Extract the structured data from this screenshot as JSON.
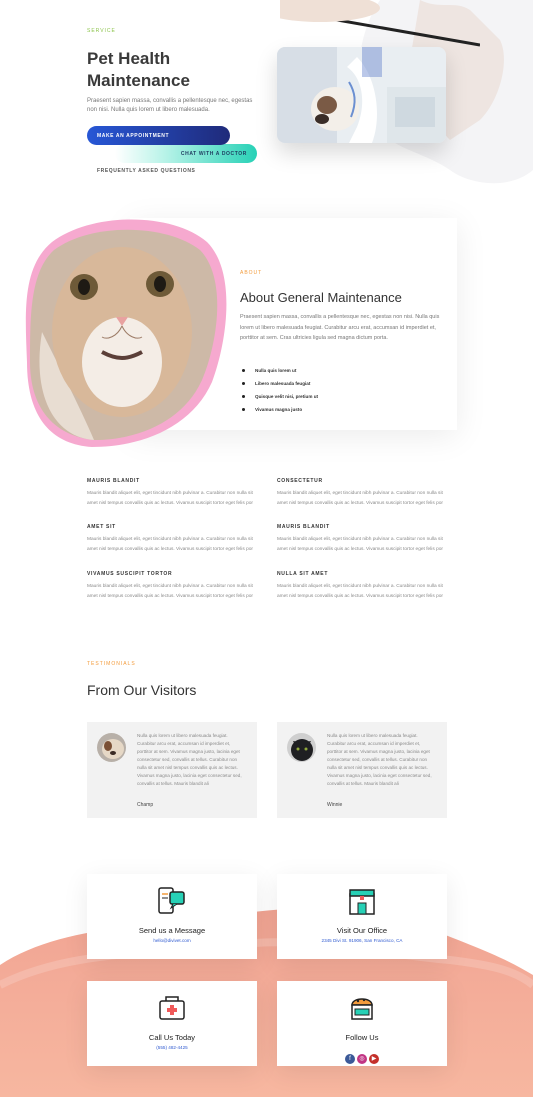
{
  "hero": {
    "eyebrow": "SERVICE",
    "title": "Pet Health Maintenance",
    "description": "Praesent sapien massa, convallis a pellentesque nec, egestas non nisi. Nulla quis lorem ut libero malesuada.",
    "appointment_button": "MAKE AN APPOINTMENT",
    "chat_button": "CHAT WITH A DOCTOR",
    "faq_link": "FREQUENTLY ASKED QUESTIONS"
  },
  "about": {
    "eyebrow": "ABOUT",
    "title": "About General Maintenance",
    "text": "Praesent sapien massa, convallis a pellentesque nec, egestas non nisi. Nulla quis lorem ut libero malesuada feugiat. Curabitur arcu erat, accumsan id imperdiet et, porttitor at sem. Cras ultricies ligula sed magna dictum porta.",
    "bullets": [
      "Nulla quis lorem ut",
      "Libero malesuada feugiat",
      "Quisque velit nisi, pretium ut",
      "Vivamus magna justo"
    ]
  },
  "features": [
    {
      "heading": "MAURIS BLANDIT",
      "text": "Mauris blandit aliquet elit, eget tincidunt nibh pulvinar a. Curabitur non nulla sit amet nisl tempus convallis quis ac lectus. Vivamus suscipit tortor eget felis por"
    },
    {
      "heading": "CONSECTETUR",
      "text": "Mauris blandit aliquet elit, eget tincidunt nibh pulvinar a. Curabitur non nulla sit amet nisl tempus convallis quis ac lectus. Vivamus suscipit tortor eget felis por"
    },
    {
      "heading": "AMET SIT",
      "text": "Mauris blandit aliquet elit, eget tincidunt nibh pulvinar a. Curabitur non nulla sit amet nisl tempus convallis quis ac lectus. Vivamus suscipit tortor eget felis por"
    },
    {
      "heading": "MAURIS BLANDIT",
      "text": "Mauris blandit aliquet elit, eget tincidunt nibh pulvinar a. Curabitur non nulla sit amet nisl tempus convallis quis ac lectus. Vivamus suscipit tortor eget felis por"
    },
    {
      "heading": "VIVAMUS SUSCIPIT TORTOR",
      "text": "Mauris blandit aliquet elit, eget tincidunt nibh pulvinar a. Curabitur non nulla sit amet nisl tempus convallis quis ac lectus. Vivamus suscipit tortor eget felis por"
    },
    {
      "heading": "NULLA SIT AMET",
      "text": "Mauris blandit aliquet elit, eget tincidunt nibh pulvinar a. Curabitur non nulla sit amet nisl tempus convallis quis ac lectus. Vivamus suscipit tortor eget felis por"
    }
  ],
  "testimonials": {
    "eyebrow": "TESTIMONIALS",
    "title": "From Our Visitors",
    "items": [
      {
        "text": "Nulla quis lorem ut libero malesuada feugiat. Curabitur arcu erat, accumsan id imperdiet et, porttitor at sem. Vivamus magna justo, lacinia eget consectetur sed, convallis at tellus. Curabitur non nulla sit amet nisl tempus convallis quis ac lectus. Vivamus magna justo, lacinia eget consectetur sed, convallis at tellus. Mauris blandit ali",
        "name": "Champ"
      },
      {
        "text": "Nulla quis lorem ut libero malesuada feugiat. Curabitur arcu erat, accumsan id imperdiet et, porttitor at sem. Vivamus magna justo, lacinia eget consectetur sed, convallis at tellus. Curabitur non nulla sit amet nisl tempus convallis quis ac lectus. Vivamus magna justo, lacinia eget consectetur sed, convallis at tellus. Mauris blandit ali",
        "name": "Winnie"
      }
    ]
  },
  "contact": {
    "message": {
      "title": "Send us a Message",
      "sub": "hello@divivet.com"
    },
    "office": {
      "title": "Visit Our Office",
      "sub": "2345 Divi St. 91906, San Francisco, CA"
    },
    "call": {
      "title": "Call Us Today",
      "sub": "(555) 482-4425"
    },
    "follow": {
      "title": "Follow Us",
      "icons": [
        "facebook-icon",
        "instagram-icon",
        "youtube-icon"
      ]
    }
  },
  "colors": {
    "accent_green": "#8bc34a",
    "accent_orange": "#f39c3d",
    "blue": "#2757d6",
    "teal": "#27d1b6",
    "coral": "#f3a08b",
    "pink": "#f6a9cf"
  }
}
